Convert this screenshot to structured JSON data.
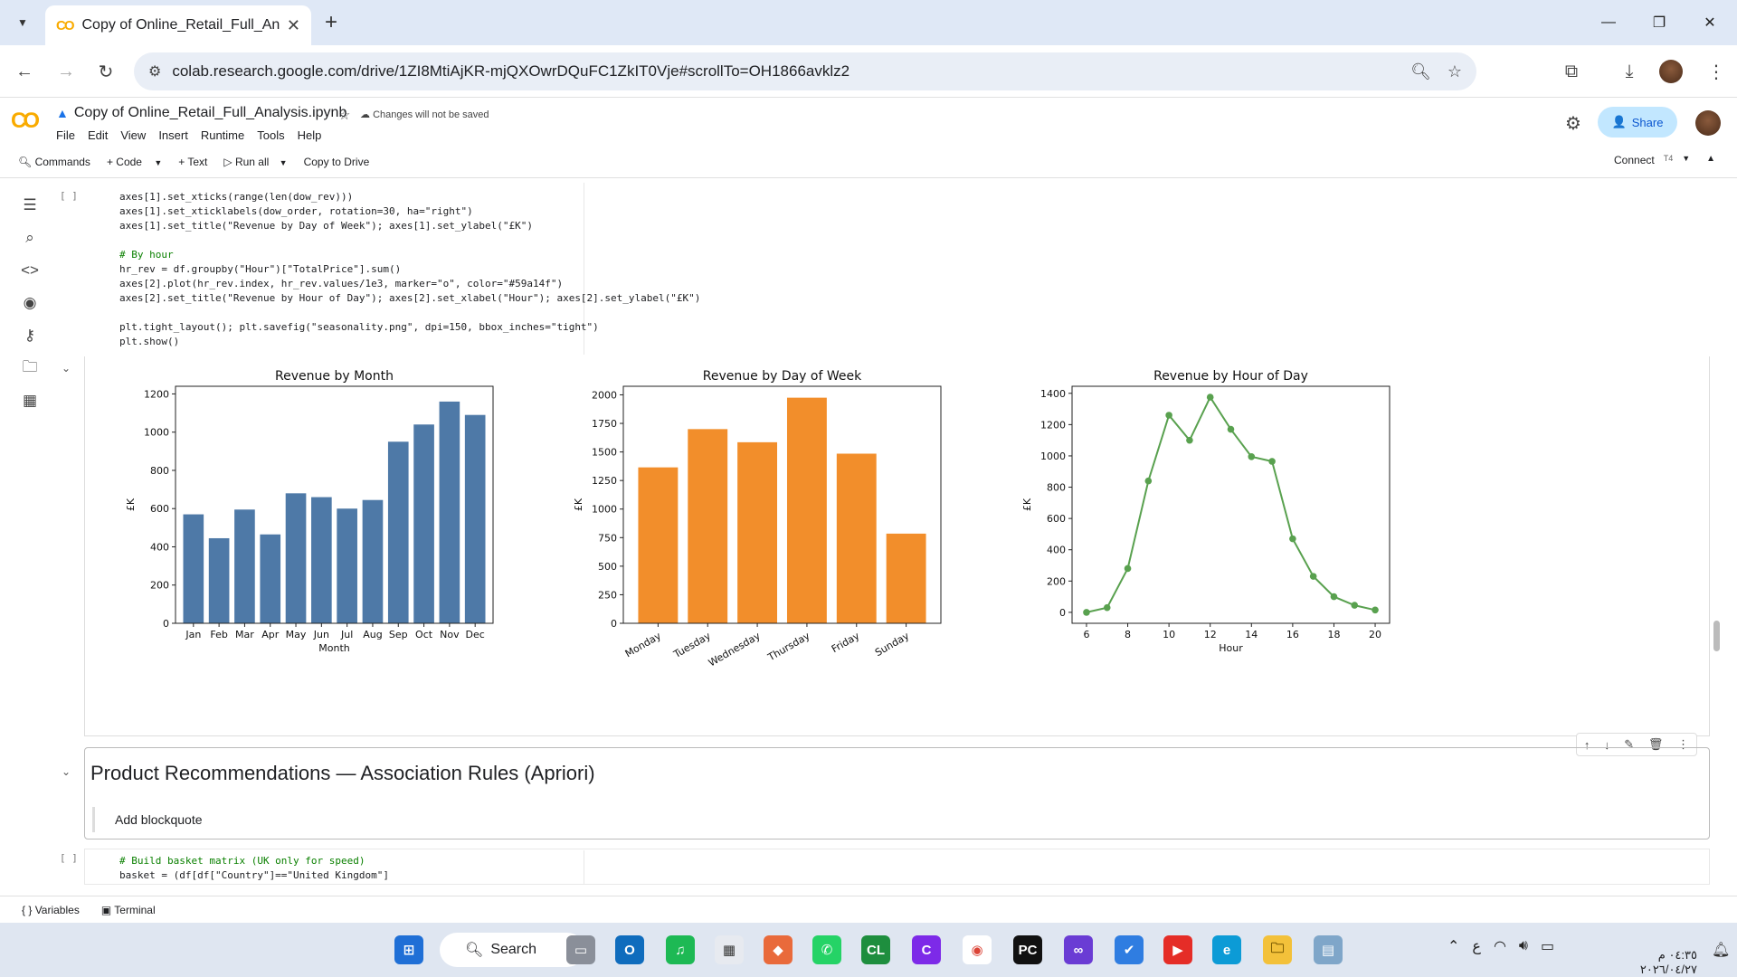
{
  "browser": {
    "tab_title": "Copy of Online_Retail_Full_Anal",
    "tab_favicon": "CO",
    "url": "colab.research.google.com/drive/1ZI8MtiAjKR-mjQXOwrDQuFC1ZkIT0Vje#scrollTo=OH1866avklz2"
  },
  "colab": {
    "logo": "CO",
    "notebook_title": "Copy of Online_Retail_Full_Analysis.ipynb",
    "unsaved_note": "Changes will not be saved",
    "menus": [
      "File",
      "Edit",
      "View",
      "Insert",
      "Runtime",
      "Tools",
      "Help"
    ],
    "share_label": "Share",
    "toolbar": {
      "commands": "Commands",
      "code": "+ Code",
      "text": "+ Text",
      "run_all": "Run all",
      "copy_drive": "Copy to Drive"
    },
    "connect": "Connect",
    "runtime_badge": "T4",
    "cell_bracket": "[ ]"
  },
  "code_lines": [
    "axes[1].set_xticks(range(len(dow_rev)))",
    "axes[1].set_xticklabels(dow_order, rotation=30, ha=\"right\")",
    "axes[1].set_title(\"Revenue by Day of Week\"); axes[1].set_ylabel(\"£K\")",
    "",
    "# By hour",
    "hr_rev = df.groupby(\"Hour\")[\"TotalPrice\"].sum()",
    "axes[2].plot(hr_rev.index, hr_rev.values/1e3, marker=\"o\", color=\"#59a14f\")",
    "axes[2].set_title(\"Revenue by Hour of Day\"); axes[2].set_xlabel(\"Hour\"); axes[2].set_ylabel(\"£K\")",
    "",
    "plt.tight_layout(); plt.savefig(\"seasonality.png\", dpi=150, bbox_inches=\"tight\")",
    "plt.show()"
  ],
  "chart_data": [
    {
      "type": "bar",
      "title": "Revenue by Month",
      "xlabel": "Month",
      "ylabel": "£K",
      "color": "#4e79a7",
      "categories": [
        "Jan",
        "Feb",
        "Mar",
        "Apr",
        "May",
        "Jun",
        "Jul",
        "Aug",
        "Sep",
        "Oct",
        "Nov",
        "Dec"
      ],
      "values": [
        570,
        445,
        595,
        465,
        680,
        660,
        600,
        645,
        950,
        1040,
        1160,
        1090
      ],
      "ylim": [
        0,
        1240
      ],
      "yticks": [
        0,
        200,
        400,
        600,
        800,
        1000,
        1200
      ]
    },
    {
      "type": "bar",
      "title": "Revenue by Day of Week",
      "xlabel": "",
      "ylabel": "£K",
      "color": "#f28e2b",
      "categories": [
        "Monday",
        "Tuesday",
        "Wednesday",
        "Thursday",
        "Friday",
        "Sunday"
      ],
      "values": [
        1365,
        1700,
        1585,
        1975,
        1485,
        785
      ],
      "ylim": [
        0,
        2075
      ],
      "yticks": [
        0,
        250,
        500,
        750,
        1000,
        1250,
        1500,
        1750,
        2000
      ]
    },
    {
      "type": "line",
      "title": "Revenue by Hour of Day",
      "xlabel": "Hour",
      "ylabel": "£K",
      "color": "#59a14f",
      "x": [
        6,
        7,
        8,
        9,
        10,
        11,
        12,
        13,
        14,
        15,
        16,
        17,
        18,
        19,
        20
      ],
      "values": [
        0,
        30,
        280,
        840,
        1260,
        1100,
        1375,
        1170,
        995,
        965,
        470,
        230,
        100,
        45,
        15
      ],
      "xlim": [
        5.3,
        20.7
      ],
      "ylim": [
        -70,
        1445
      ],
      "xticks": [
        6,
        8,
        10,
        12,
        14,
        16,
        18,
        20
      ],
      "yticks": [
        0,
        200,
        400,
        600,
        800,
        1000,
        1200,
        1400
      ]
    }
  ],
  "markdown": {
    "heading": "Product Recommendations — Association Rules (Apriori)",
    "quote": "Add blockquote"
  },
  "code2_lines": [
    "# Build basket matrix (UK only for speed)",
    "basket = (df[df[\"Country\"]==\"United Kingdom\"]"
  ],
  "statusbar": {
    "variables": "Variables",
    "terminal": "Terminal"
  },
  "taskbar": {
    "search": "Search",
    "clock_time": "٠٤:٣٥ م",
    "clock_date": "٢٠٢٦/٠٤/٢٧",
    "lang": "ع"
  }
}
